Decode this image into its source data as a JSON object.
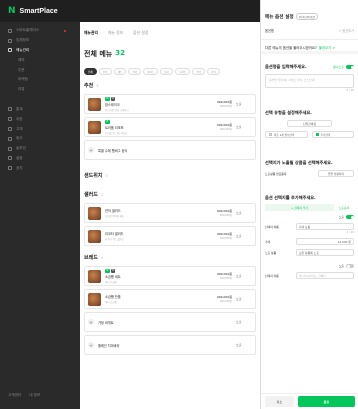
{
  "brand": {
    "logo": "N",
    "name": "SmartPlace"
  },
  "sidebar": {
    "items": [
      {
        "label": "스마트플레이스",
        "active": false
      },
      {
        "label": "업체정보",
        "active": false
      },
      {
        "label": "메뉴관리",
        "active": true
      },
      {
        "label": "예약",
        "active": false
      },
      {
        "label": "주문",
        "active": false
      },
      {
        "label": "마케팅",
        "active": false
      },
      {
        "label": "리뷰",
        "active": false
      },
      {
        "label": "통계",
        "active": false
      },
      {
        "label": "쿠폰",
        "active": false
      },
      {
        "label": "고객",
        "active": false
      },
      {
        "label": "광고",
        "active": false
      },
      {
        "label": "솔루션",
        "active": false
      },
      {
        "label": "설정",
        "active": false
      },
      {
        "label": "공지",
        "active": false
      }
    ],
    "bottom": [
      "고객센터",
      "내 정보"
    ]
  },
  "main": {
    "tabs": [
      {
        "label": "메뉴관리",
        "active": true
      },
      {
        "label": "메뉴 정보",
        "active": false
      },
      {
        "label": "옵션 설정",
        "active": false
      }
    ],
    "title": "전체 메뉴",
    "count": "32",
    "chips": [
      "전체",
      "추천",
      "세트",
      "식사",
      "사이드",
      "음료",
      "디저트",
      "주류",
      "기타"
    ],
    "sections": [
      {
        "title": "추천",
        "count": "3",
        "items": [
          {
            "name": "참스테이크",
            "desc": "부드러운 안심 스테이크",
            "price": "999,000원",
            "price2": "999,000원",
            "exposure": "노출"
          },
          {
            "name": "트러플 리조또",
            "desc": "트러플 향 크림 리조또",
            "price": "999,000원",
            "price2": "999,000원",
            "exposure": "노출"
          },
          {
            "name": "특별 수제 햄버그 정식",
            "desc": "",
            "price": "",
            "price2": "",
            "exposure": ""
          }
        ]
      },
      {
        "title": "샌드위치",
        "count": "0",
        "items": []
      },
      {
        "title": "샐러드",
        "count": "2",
        "items": [
          {
            "name": "연어 샐러드",
            "desc": "신선한 연어와 채소",
            "price": "999,000원",
            "price2": "999,000원",
            "exposure": "노출"
          },
          {
            "name": "리코타 샐러드",
            "desc": "리코타 치즈 샐러드",
            "price": "999,000원",
            "price2": "999,000원",
            "exposure": "노출"
          }
        ]
      },
      {
        "title": "브레드",
        "count": "4",
        "items": [
          {
            "name": "소금빵 세트",
            "desc": "버터 소금빵",
            "price": "999,000원",
            "price2": "999,000원",
            "exposure": "노출"
          },
          {
            "name": "소금빵 단품",
            "desc": "버터 소금빵",
            "price": "999,000원",
            "price2": "999,000원",
            "exposure": "노출"
          },
          {
            "name": "가정 바게트",
            "desc": "",
            "price": "",
            "price2": "",
            "exposure": "노출"
          },
          {
            "name": "플레인 치아바타",
            "desc": "",
            "price": "",
            "price2": "",
            "exposure": "노출"
          }
        ]
      }
    ]
  },
  "panel": {
    "title": "메뉴 옵션 설정",
    "badge": "1단계 선택 옵션",
    "tab_left": "옵션명",
    "tab_right": "+ 옵션추가",
    "question": "다른 메뉴의 옵션을 불러오시겠어요?",
    "question_link": "불러오기 >",
    "name_h": "옵션명을 입력해주세요.",
    "required_label": "필수노출",
    "name_placeholder": "옵션명 입력(예: 사이즈 선택, 소스선택)",
    "name_count": "0 / 20",
    "type_h": "선택 유형을 설정해주세요.",
    "type_select": "단일선택형",
    "chk1": "최소 1개 필수선택",
    "chk2": "추가선택",
    "expose_h": "선택지가 노출될 상품을 선택해주세요.",
    "expose_label": "노출상품 필요동작",
    "expose_select": "일괄 설정하기",
    "add_h": "옵션 선택지를 추가해주세요.",
    "add_btn": "+ 선택지 추가",
    "add_btn2": "노출순서",
    "expose_toggle": "노출",
    "choice_name_label": "선택지 이름",
    "choice_name_val": "사과 토핑",
    "choice_count": "4 / 20",
    "price_label": "가격",
    "price_val": "14,000",
    "price_unit": "원",
    "product_label": "노출 상품",
    "product_val": "모든 상품에 노출",
    "expose2": "노출",
    "choice_name_label2": "선택지 이름",
    "choice_placeholder": "예) 라지사이즈, 곱빼기",
    "cancel": "취소",
    "save": "완료"
  }
}
